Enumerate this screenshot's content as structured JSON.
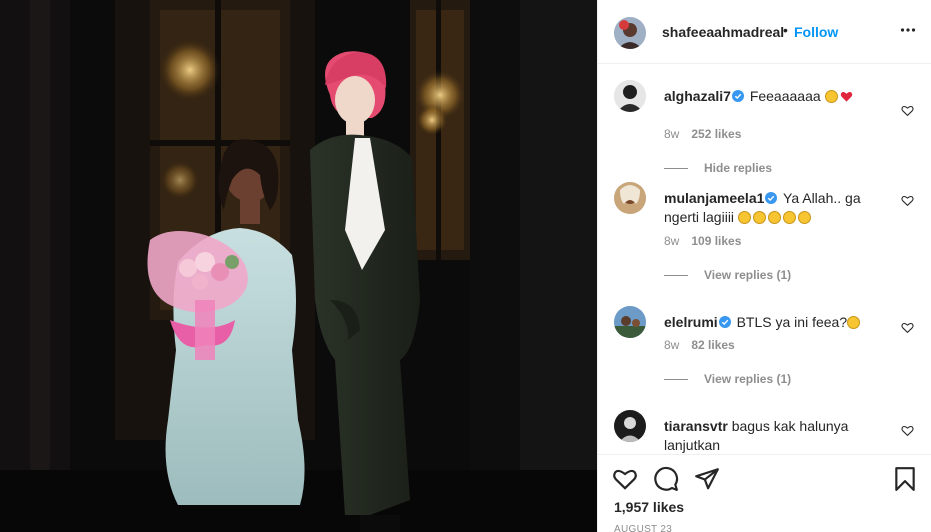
{
  "post": {
    "username": "shafeeaahmadreal",
    "separator": "•",
    "follow_label": "Follow",
    "likes_count": "1,957 likes",
    "date": "AUGUST 23"
  },
  "comments": [
    {
      "username": "alghazali7",
      "text": "Feeaaaaaa",
      "age": "8w",
      "likes": "252 likes",
      "replies_label": "Hide replies"
    },
    {
      "username": "mulanjameela1",
      "text": "Ya Allah.. ga ngerti lagiiii",
      "age": "8w",
      "likes": "109 likes",
      "replies_label": "View replies (1)"
    },
    {
      "username": "elelrumi",
      "text": "BTLS ya ini feea?",
      "age": "8w",
      "likes": "82 likes",
      "replies_label": "View replies (1)"
    },
    {
      "username": "tiaransvtr",
      "text": "bagus kak halunya lanjutkan"
    }
  ],
  "colors": {
    "accent": "#0095f6",
    "text": "#262626",
    "muted": "#8e8e8e",
    "border": "#efefef",
    "verified": "#3897f0",
    "heart": "#ed4956"
  },
  "icons": [
    "more-icon",
    "verified-badge-icon",
    "heart-outline-icon",
    "comment-icon",
    "share-icon",
    "bookmark-icon"
  ]
}
